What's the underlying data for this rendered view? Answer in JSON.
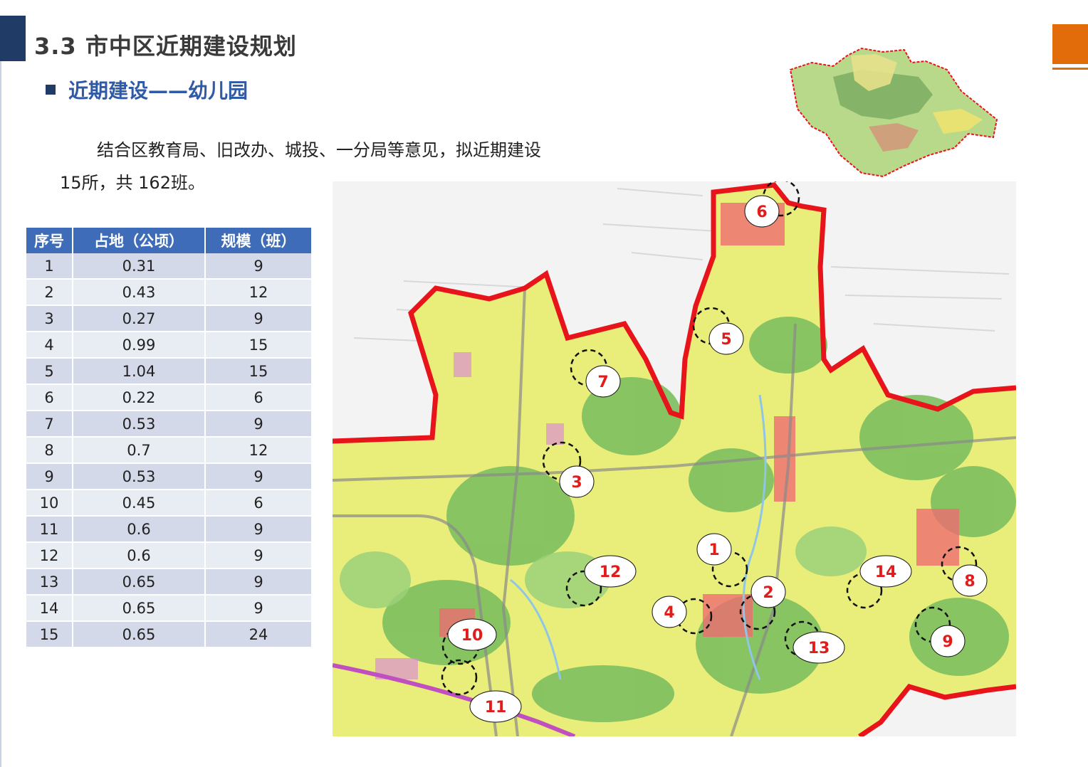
{
  "header": {
    "title": "3.3 市中区近期建设规划",
    "subtitle": "近期建设——幼儿园"
  },
  "intro": {
    "line1": "结合区教育局、旧改办、城投、一分局等意见，拟近期建设",
    "line2": "15所，共 162班。"
  },
  "table": {
    "columns": [
      "序号",
      "占地（公顷）",
      "规模（班）"
    ],
    "rows": [
      [
        "1",
        "0.31",
        "9"
      ],
      [
        "2",
        "0.43",
        "12"
      ],
      [
        "3",
        "0.27",
        "9"
      ],
      [
        "4",
        "0.99",
        "15"
      ],
      [
        "5",
        "1.04",
        "15"
      ],
      [
        "6",
        "0.22",
        "6"
      ],
      [
        "7",
        "0.53",
        "9"
      ],
      [
        "8",
        "0.7",
        "12"
      ],
      [
        "9",
        "0.53",
        "9"
      ],
      [
        "10",
        "0.45",
        "6"
      ],
      [
        "11",
        "0.6",
        "9"
      ],
      [
        "12",
        "0.6",
        "9"
      ],
      [
        "13",
        "0.65",
        "9"
      ],
      [
        "14",
        "0.65",
        "9"
      ],
      [
        "15",
        "0.65",
        "24"
      ]
    ]
  },
  "map": {
    "site_labels": [
      "1",
      "2",
      "3",
      "4",
      "5",
      "6",
      "7",
      "8",
      "9",
      "10",
      "11",
      "12",
      "13",
      "14"
    ]
  },
  "colors": {
    "header_bar": "#1f3b66",
    "accent_orange": "#e36c0a",
    "subtitle_blue": "#2e5aa6",
    "table_header": "#3e6cb8",
    "boundary_red": "#e8141b"
  }
}
